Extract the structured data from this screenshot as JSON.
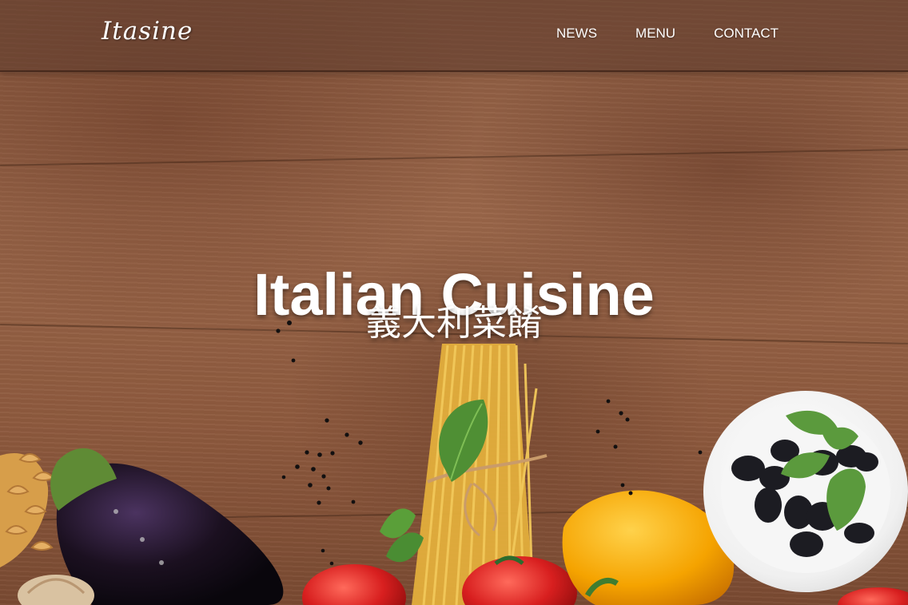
{
  "header": {
    "logo_text": "Itasine",
    "nav": [
      "NEWS",
      "MENU",
      "CONTACT"
    ]
  },
  "hero": {
    "title": "Italian Cuisine",
    "subtitle": "義大利菜餚"
  },
  "colors": {
    "text": "#ffffff",
    "wood": "#8b5a40"
  }
}
